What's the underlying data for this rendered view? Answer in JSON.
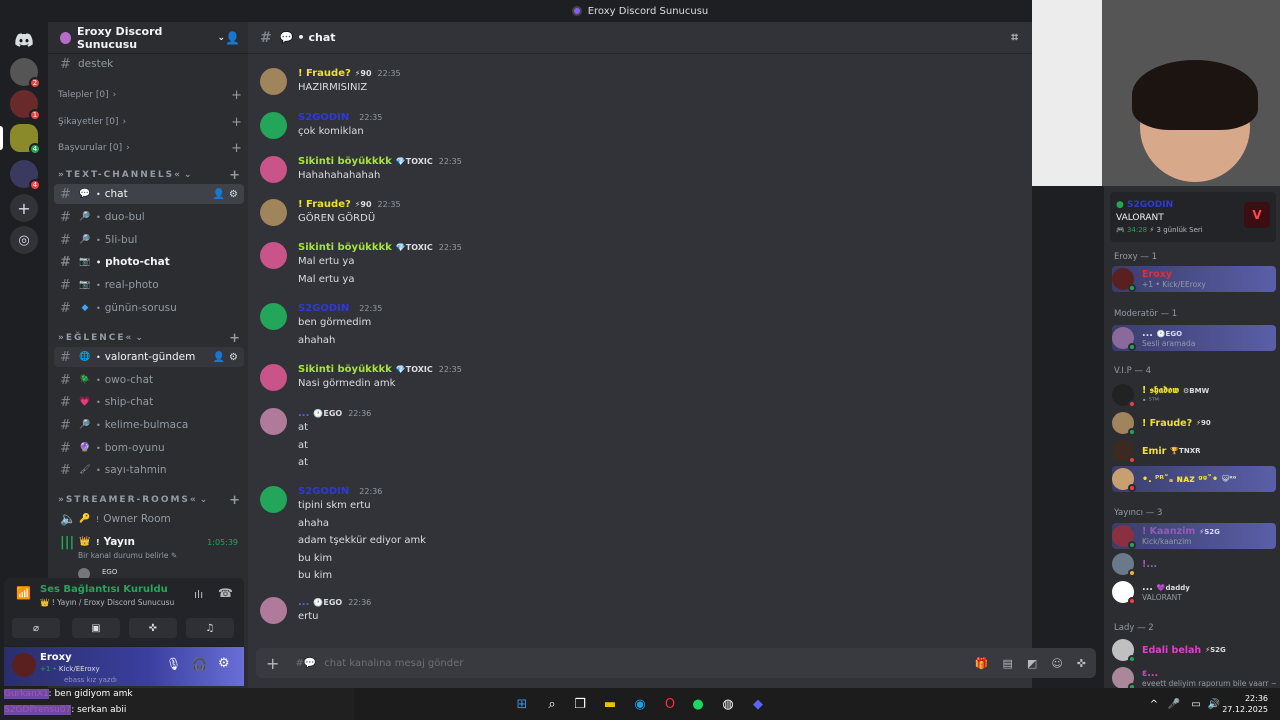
{
  "window": {
    "title": "Eroxy Discord Sunucusu"
  },
  "guilds": {
    "badges": [
      "2",
      "1",
      "4",
      "4"
    ],
    "icons": [
      "discord-home-icon",
      "add-server-icon",
      "explore-icon"
    ]
  },
  "server": {
    "name": "Eroxy Discord Sunucusu",
    "categories": {
      "talepler": "Talepler [0]",
      "sikayetler": "Şikayetler [0]",
      "basvurular": "Başvurular [0]",
      "text": "»TEXT-CHANNELS«",
      "eglence": "»EĞLENCE«",
      "streamer": "»STREAMER-ROOMS«"
    },
    "channels": [
      {
        "name": "destek",
        "emoji": ""
      },
      {
        "name": "chat",
        "emoji": "💬"
      },
      {
        "name": "duo-bul",
        "emoji": "🔎"
      },
      {
        "name": "5li-bul",
        "emoji": "🔎"
      },
      {
        "name": "photo-chat",
        "emoji": "📷"
      },
      {
        "name": "real-photo",
        "emoji": "📷"
      },
      {
        "name": "günün-sorusu",
        "emoji": "◆"
      },
      {
        "name": "valorant-gündem",
        "emoji": "🌐"
      },
      {
        "name": "owo-chat",
        "emoji": "🪲"
      },
      {
        "name": "ship-chat",
        "emoji": "💗"
      },
      {
        "name": "kelime-bulmaca",
        "emoji": "🔎"
      },
      {
        "name": "bom-oyunu",
        "emoji": "🔮"
      },
      {
        "name": "sayı-tahmin",
        "emoji": "🖌"
      }
    ],
    "voice": [
      {
        "name": "Owner Room",
        "emoji": "🔑"
      },
      {
        "name": "Yayın",
        "emoji": "👑",
        "timer": "1:05:39",
        "status": "Bir kanal durumu belirle"
      }
    ],
    "voice_user_tag": "EGO"
  },
  "voice_panel": {
    "status": "Ses Bağlantısı Kuruldu",
    "location": "Yayın / Eroxy Discord Sunucusu"
  },
  "user_panel": {
    "name": "Eroxy",
    "status": "Kick/EEroxy",
    "status_prefix": "+1 •",
    "subtext": "ebass kız yazdı"
  },
  "channel": {
    "name": "chat",
    "input_placeholder": "chat kanalına mesaj gönder"
  },
  "messages": [
    {
      "author": "! Fraude?",
      "color": "#f0e130",
      "tag": "⚡90",
      "time": "22:35",
      "lines": [
        "HAZIRMISINIZ"
      ]
    },
    {
      "author": "S2GODIN",
      "color": "#2e3ad6",
      "tag": "",
      "time": "22:35",
      "lines": [
        "çok komiklan"
      ]
    },
    {
      "author": "Sikinti böyükkkk",
      "color": "#a5e634",
      "tag": "💎TOXIC",
      "time": "22:35",
      "lines": [
        "Hahahahahahah"
      ]
    },
    {
      "author": "! Fraude?",
      "color": "#f0e130",
      "tag": "⚡90",
      "time": "22:35",
      "lines": [
        "GÖREN GÖRDÜ"
      ]
    },
    {
      "author": "Sikinti böyükkkk",
      "color": "#a5e634",
      "tag": "💎TOXIC",
      "time": "22:35",
      "lines": [
        "Mal ertu ya",
        "Mal ertu ya"
      ]
    },
    {
      "author": "S2GODIN",
      "color": "#2e3ad6",
      "tag": "",
      "time": "22:35",
      "lines": [
        "ben görmedim",
        "ahahah"
      ]
    },
    {
      "author": "Sikinti böyükkkk",
      "color": "#a5e634",
      "tag": "💎TOXIC",
      "time": "22:35",
      "lines": [
        "Nasi görmedin amk"
      ]
    },
    {
      "author": "...",
      "color": "#5865f2",
      "tag": "🕐EGO",
      "time": "22:36",
      "lines": [
        "at",
        "at",
        "at"
      ]
    },
    {
      "author": "S2GODIN",
      "color": "#2e3ad6",
      "tag": "",
      "time": "22:36",
      "lines": [
        "tipini skm ertu",
        "ahaha",
        "adam tşekkür ediyor amk",
        "bu kim",
        "bu kim"
      ]
    },
    {
      "author": "...",
      "color": "#5865f2",
      "tag": "🕐EGO",
      "time": "22:36",
      "lines": [
        "ertu"
      ]
    }
  ],
  "activity": {
    "name": "S2GODIN",
    "game": "VALORANT",
    "time": "34:28",
    "streak": "3 günlük Seri"
  },
  "members": {
    "groups": [
      {
        "title": "Eroxy — 1"
      },
      {
        "title": "Moderatör — 1"
      },
      {
        "title": "V.I.P — 4"
      },
      {
        "title": "Yayıncı — 3"
      },
      {
        "title": "Lady — 2"
      }
    ],
    "list": [
      {
        "name": "Eroxy",
        "color": "#e03030",
        "sub": "+1 • Kick/EEroxy",
        "tag": ""
      },
      {
        "name": "...",
        "color": "#dbdee1",
        "sub": "Sesli aramada",
        "tag": "🕐EGO"
      },
      {
        "name": "! 𝖘𝖍𝖆𝖉𝖔𝖜",
        "color": "#f0e130",
        "sub": "• ⁵ᵀᴹ",
        "tag": "⚙BMW"
      },
      {
        "name": "! Fraude?",
        "color": "#f0e130",
        "sub": "",
        "tag": "⚡90"
      },
      {
        "name": "Emir",
        "color": "#f0e130",
        "sub": "",
        "tag": "🏆TNXR"
      },
      {
        "name": "•. ᴾᴿ˚ₐ ɴᴀᴢ ᵍᵍ˚•",
        "color": "#f0e130",
        "sub": "",
        "tag": "😺ᴿᴳ"
      },
      {
        "name": "! Kaanzim",
        "color": "#9b59b6",
        "sub": "Kick/kaanzim",
        "tag": "⚡S2G"
      },
      {
        "name": "!...",
        "color": "#9b59b6",
        "sub": "",
        "tag": ""
      },
      {
        "name": "...",
        "color": "#dbdee1",
        "sub": "VALORANT",
        "tag": "💜daddy"
      },
      {
        "name": "Edali belah",
        "color": "#e040c8",
        "sub": "",
        "tag": "⚡S2G"
      },
      {
        "name": "ε...",
        "color": "#e040c8",
        "sub": "eveett deliyim raporum bile vaarr ~",
        "tag": ""
      }
    ]
  },
  "overlay_chat": [
    {
      "user": "GurkanX1",
      "text": ": ben gidiyom amk"
    },
    {
      "user": "S2GDPrensu07",
      "text": ": serkan abii"
    }
  ],
  "taskbar": {
    "time": "22:36",
    "date": "27.12.2025"
  }
}
